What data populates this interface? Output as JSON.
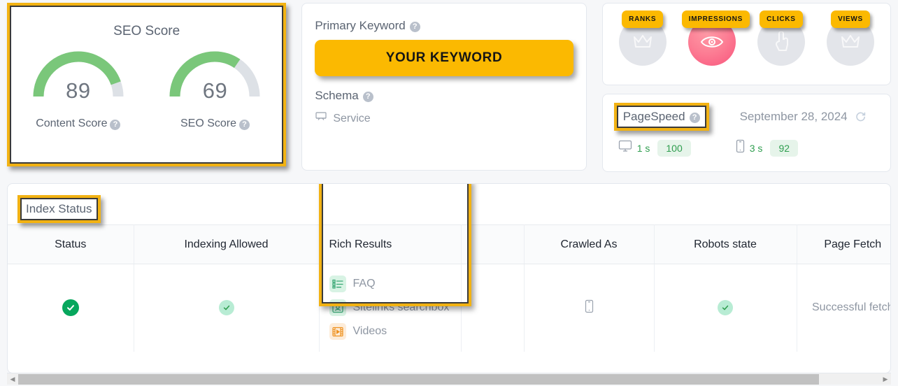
{
  "seo_card": {
    "title": "SEO Score",
    "gauges": [
      {
        "value": "89",
        "pct": 89,
        "label": "Content Score",
        "help": "?"
      },
      {
        "value": "69",
        "pct": 69,
        "label": "SEO Score",
        "help": "?"
      }
    ]
  },
  "keyword_card": {
    "primary_keyword_label": "Primary Keyword",
    "primary_keyword_help": "?",
    "keyword_value": "YOUR KEYWORD",
    "schema_label": "Schema",
    "schema_help": "?",
    "schema_items": [
      {
        "icon": "service-icon",
        "label": "Service"
      }
    ]
  },
  "metrics_card": {
    "items": [
      {
        "label": "RANKS",
        "icon": "crown-icon",
        "active": false
      },
      {
        "label": "IMPRESSIONS",
        "icon": "eye-icon",
        "active": true
      },
      {
        "label": "CLICKS",
        "icon": "click-hand-icon",
        "active": false
      },
      {
        "label": "VIEWS",
        "icon": "crown-icon",
        "active": false
      }
    ]
  },
  "pagespeed_card": {
    "title": "PageSpeed",
    "help": "?",
    "date": "September 28, 2024",
    "refresh_icon": "refresh-icon",
    "desktop": {
      "icon": "desktop-icon",
      "time": "1 s",
      "score": "100"
    },
    "mobile": {
      "icon": "mobile-icon",
      "time": "3 s",
      "score": "92"
    }
  },
  "index_panel": {
    "title": "Index Status",
    "columns": [
      "Status",
      "Indexing Allowed",
      "Rich Results",
      "",
      "Crawled As",
      "Robots state",
      "Page Fetch"
    ],
    "row": {
      "status_icon": "check-circle-solid-icon",
      "indexing_allowed_icon": "check-circle-soft-icon",
      "rich_results": [
        {
          "label": "FAQ",
          "icon": "faq-list-icon",
          "tone": "green"
        },
        {
          "label": "Sitelinks searchbox",
          "icon": "sitelinks-searchbox-icon",
          "tone": "green"
        },
        {
          "label": "Videos",
          "icon": "videos-film-icon",
          "tone": "orange"
        }
      ],
      "crawled_as_icon": "mobile-icon",
      "robots_state_icon": "check-circle-soft-icon",
      "page_fetch": "Successful fetch"
    }
  },
  "scrollbar": {
    "left_arrow": "chevron-left-icon",
    "right_arrow": "chevron-right-icon"
  },
  "colors": {
    "accent": "#fbb901",
    "highlight": "#f2b213",
    "gauge_green": "#7ac77a",
    "gauge_track": "#dde1e6",
    "ok_green": "#07a75d",
    "soft_green": "#b8ecd4",
    "impressions_pink": "#f9547c",
    "page_bg": "#f6f7f9"
  }
}
